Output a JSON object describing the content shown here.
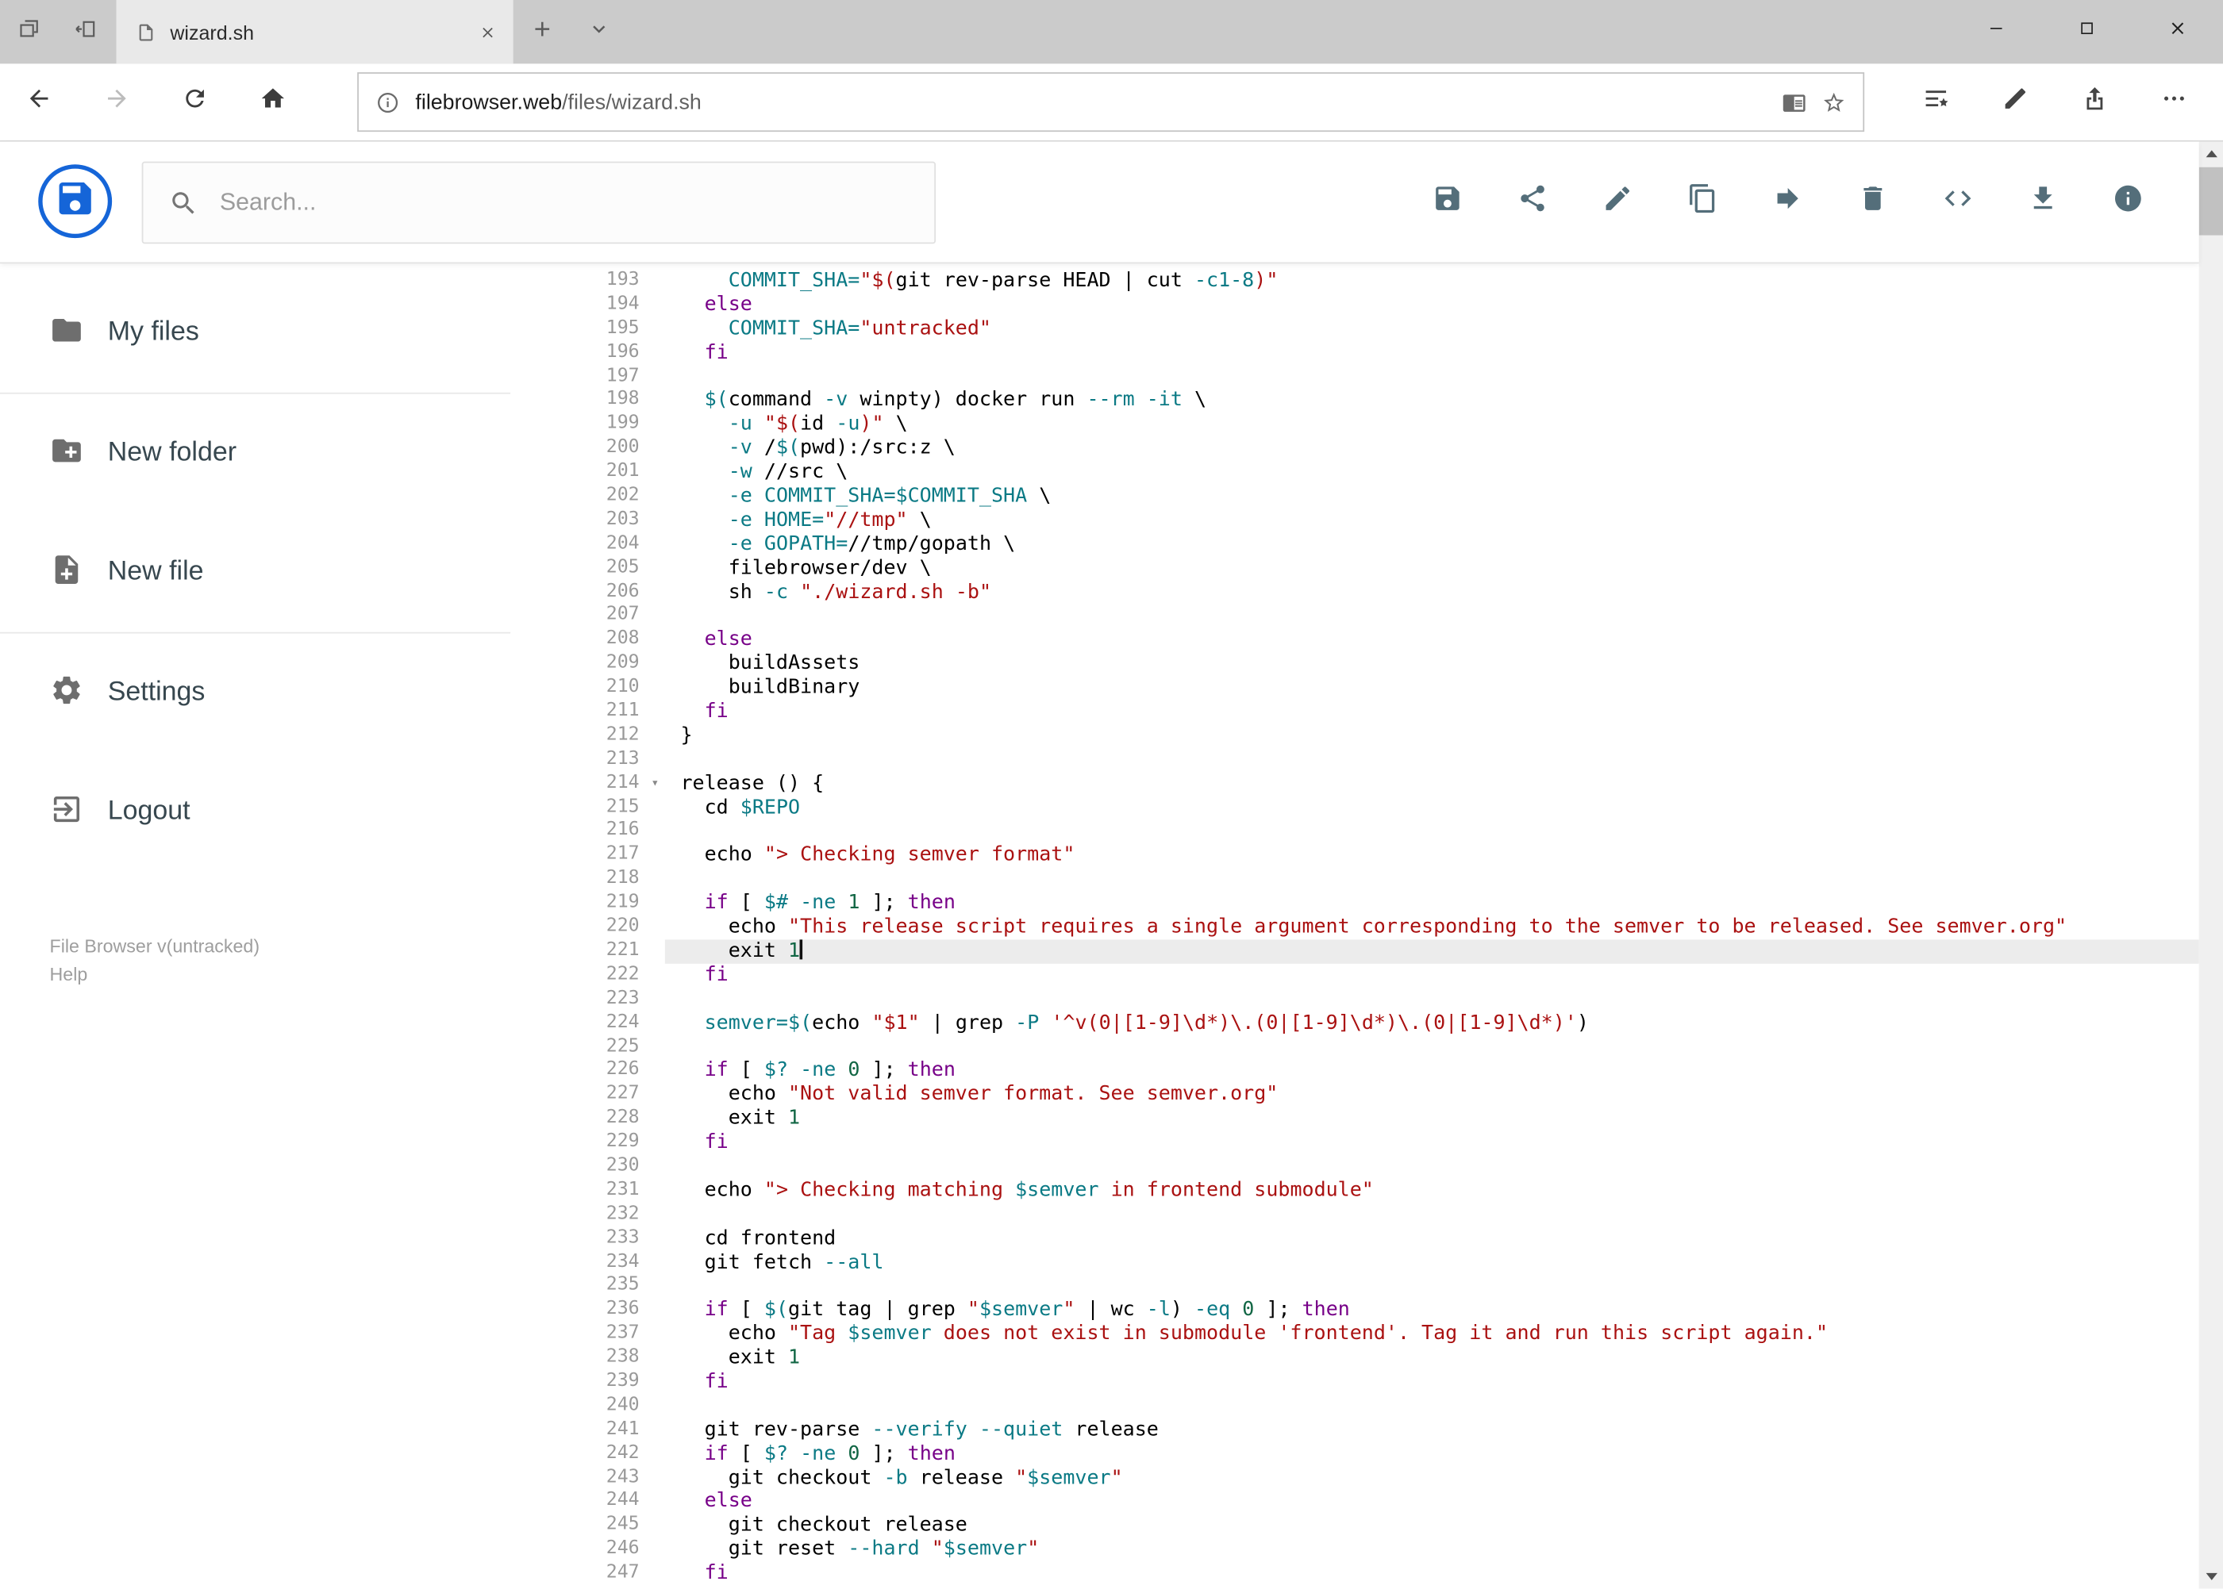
{
  "browser": {
    "tab_title": "wizard.sh",
    "url_domain": "filebrowser.web",
    "url_path": "/files/wizard.sh"
  },
  "app": {
    "search_placeholder": "Search...",
    "sidebar": {
      "items": [
        {
          "label": "My files"
        },
        {
          "label": "New folder"
        },
        {
          "label": "New file"
        },
        {
          "label": "Settings"
        },
        {
          "label": "Logout"
        }
      ],
      "version": "File Browser v(untracked)",
      "help": "Help"
    },
    "icons": {
      "tabstrip": [
        "tabs-preview-icon",
        "set-tabs-aside-icon",
        "page-icon",
        "close-tab-icon",
        "new-tab-icon",
        "tab-actions-chevron-icon",
        "minimize-icon",
        "maximize-icon",
        "close-window-icon"
      ],
      "navbar": [
        "back-icon",
        "forward-icon",
        "refresh-icon",
        "home-icon",
        "page-info-icon",
        "reading-view-icon",
        "favorite-star-icon",
        "hub-icon",
        "web-note-icon",
        "share-icon",
        "more-icon"
      ],
      "header": [
        "logo-icon",
        "search-icon",
        "save-icon",
        "share-icon",
        "rename-icon",
        "copy-icon",
        "move-icon",
        "delete-icon",
        "switch-view-icon",
        "download-icon",
        "info-icon"
      ],
      "sidebar": [
        "folder-icon",
        "new-folder-icon",
        "new-file-icon",
        "settings-icon",
        "logout-icon"
      ]
    }
  },
  "editor": {
    "active_line": 221,
    "fold_line": 214,
    "colors": {
      "keyword": "#770088",
      "string": "#aa1111",
      "variable": "#0b7a85",
      "number": "#116644",
      "plain": "#000000",
      "line_number": "#999999",
      "active_line_bg": "#ececec"
    },
    "lines": [
      {
        "n": 193,
        "seg": [
          [
            "p",
            "    "
          ],
          [
            "v",
            "COMMIT_SHA="
          ],
          [
            "s",
            "\"$("
          ],
          [
            "p",
            "git rev-parse HEAD | cut "
          ],
          [
            "v",
            "-c1-8"
          ],
          [
            "s",
            ")\""
          ]
        ]
      },
      {
        "n": 194,
        "seg": [
          [
            "p",
            "  "
          ],
          [
            "k",
            "else"
          ]
        ]
      },
      {
        "n": 195,
        "seg": [
          [
            "p",
            "    "
          ],
          [
            "v",
            "COMMIT_SHA="
          ],
          [
            "s",
            "\"untracked\""
          ]
        ]
      },
      {
        "n": 196,
        "seg": [
          [
            "p",
            "  "
          ],
          [
            "k",
            "fi"
          ]
        ]
      },
      {
        "n": 197,
        "seg": []
      },
      {
        "n": 198,
        "seg": [
          [
            "p",
            "  "
          ],
          [
            "v",
            "$("
          ],
          [
            "p",
            "command "
          ],
          [
            "v",
            "-v"
          ],
          [
            "p",
            " winpty) docker run "
          ],
          [
            "v",
            "--rm"
          ],
          [
            "p",
            " "
          ],
          [
            "v",
            "-it"
          ],
          [
            "p",
            " \\"
          ]
        ]
      },
      {
        "n": 199,
        "seg": [
          [
            "p",
            "    "
          ],
          [
            "v",
            "-u"
          ],
          [
            "p",
            " "
          ],
          [
            "s",
            "\"$("
          ],
          [
            "p",
            "id "
          ],
          [
            "v",
            "-u"
          ],
          [
            "s",
            ")\""
          ],
          [
            "p",
            " \\"
          ]
        ]
      },
      {
        "n": 200,
        "seg": [
          [
            "p",
            "    "
          ],
          [
            "v",
            "-v"
          ],
          [
            "p",
            " /"
          ],
          [
            "v",
            "$("
          ],
          [
            "p",
            "pwd):/src:z \\"
          ]
        ]
      },
      {
        "n": 201,
        "seg": [
          [
            "p",
            "    "
          ],
          [
            "v",
            "-w"
          ],
          [
            "p",
            " //src \\"
          ]
        ]
      },
      {
        "n": 202,
        "seg": [
          [
            "p",
            "    "
          ],
          [
            "v",
            "-e"
          ],
          [
            "p",
            " "
          ],
          [
            "v",
            "COMMIT_SHA=$COMMIT_SHA"
          ],
          [
            "p",
            " \\"
          ]
        ]
      },
      {
        "n": 203,
        "seg": [
          [
            "p",
            "    "
          ],
          [
            "v",
            "-e"
          ],
          [
            "p",
            " "
          ],
          [
            "v",
            "HOME="
          ],
          [
            "s",
            "\"//tmp\""
          ],
          [
            "p",
            " \\"
          ]
        ]
      },
      {
        "n": 204,
        "seg": [
          [
            "p",
            "    "
          ],
          [
            "v",
            "-e"
          ],
          [
            "p",
            " "
          ],
          [
            "v",
            "GOPATH="
          ],
          [
            "p",
            "//tmp/gopath \\"
          ]
        ]
      },
      {
        "n": 205,
        "seg": [
          [
            "p",
            "    filebrowser/dev \\"
          ]
        ]
      },
      {
        "n": 206,
        "seg": [
          [
            "p",
            "    sh "
          ],
          [
            "v",
            "-c"
          ],
          [
            "p",
            " "
          ],
          [
            "s",
            "\"./wizard.sh -b\""
          ]
        ]
      },
      {
        "n": 207,
        "seg": []
      },
      {
        "n": 208,
        "seg": [
          [
            "p",
            "  "
          ],
          [
            "k",
            "else"
          ]
        ]
      },
      {
        "n": 209,
        "seg": [
          [
            "p",
            "    buildAssets"
          ]
        ]
      },
      {
        "n": 210,
        "seg": [
          [
            "p",
            "    buildBinary"
          ]
        ]
      },
      {
        "n": 211,
        "seg": [
          [
            "p",
            "  "
          ],
          [
            "k",
            "fi"
          ]
        ]
      },
      {
        "n": 212,
        "seg": [
          [
            "p",
            "}"
          ]
        ]
      },
      {
        "n": 213,
        "seg": []
      },
      {
        "n": 214,
        "seg": [
          [
            "p",
            "release () {"
          ]
        ]
      },
      {
        "n": 215,
        "seg": [
          [
            "p",
            "  cd "
          ],
          [
            "v",
            "$REPO"
          ]
        ]
      },
      {
        "n": 216,
        "seg": []
      },
      {
        "n": 217,
        "seg": [
          [
            "p",
            "  echo "
          ],
          [
            "s",
            "\"> Checking semver format\""
          ]
        ]
      },
      {
        "n": 218,
        "seg": []
      },
      {
        "n": 219,
        "seg": [
          [
            "p",
            "  "
          ],
          [
            "k",
            "if"
          ],
          [
            "p",
            " [ "
          ],
          [
            "v",
            "$#"
          ],
          [
            "p",
            " "
          ],
          [
            "v",
            "-ne"
          ],
          [
            "p",
            " "
          ],
          [
            "nu",
            "1"
          ],
          [
            "p",
            " ]; "
          ],
          [
            "k",
            "then"
          ]
        ]
      },
      {
        "n": 220,
        "seg": [
          [
            "p",
            "    echo "
          ],
          [
            "s",
            "\"This release script requires a single argument corresponding to the semver to be released. See semver.org\""
          ]
        ]
      },
      {
        "n": 221,
        "seg": [
          [
            "p",
            "    exit "
          ],
          [
            "nu",
            "1"
          ]
        ]
      },
      {
        "n": 222,
        "seg": [
          [
            "p",
            "  "
          ],
          [
            "k",
            "fi"
          ]
        ]
      },
      {
        "n": 223,
        "seg": []
      },
      {
        "n": 224,
        "seg": [
          [
            "p",
            "  "
          ],
          [
            "v",
            "semver="
          ],
          [
            "v",
            "$("
          ],
          [
            "p",
            "echo "
          ],
          [
            "s",
            "\"$1\""
          ],
          [
            "p",
            " | grep "
          ],
          [
            "v",
            "-P"
          ],
          [
            "p",
            " "
          ],
          [
            "s",
            "'^v(0|[1-9]\\d*)\\.(0|[1-9]\\d*)\\.(0|[1-9]\\d*)'"
          ],
          [
            "p",
            ")"
          ]
        ]
      },
      {
        "n": 225,
        "seg": []
      },
      {
        "n": 226,
        "seg": [
          [
            "p",
            "  "
          ],
          [
            "k",
            "if"
          ],
          [
            "p",
            " [ "
          ],
          [
            "v",
            "$?"
          ],
          [
            "p",
            " "
          ],
          [
            "v",
            "-ne"
          ],
          [
            "p",
            " "
          ],
          [
            "nu",
            "0"
          ],
          [
            "p",
            " ]; "
          ],
          [
            "k",
            "then"
          ]
        ]
      },
      {
        "n": 227,
        "seg": [
          [
            "p",
            "    echo "
          ],
          [
            "s",
            "\"Not valid semver format. See semver.org\""
          ]
        ]
      },
      {
        "n": 228,
        "seg": [
          [
            "p",
            "    exit "
          ],
          [
            "nu",
            "1"
          ]
        ]
      },
      {
        "n": 229,
        "seg": [
          [
            "p",
            "  "
          ],
          [
            "k",
            "fi"
          ]
        ]
      },
      {
        "n": 230,
        "seg": []
      },
      {
        "n": 231,
        "seg": [
          [
            "p",
            "  echo "
          ],
          [
            "s",
            "\"> Checking matching "
          ],
          [
            "v",
            "$semver"
          ],
          [
            "s",
            " in frontend submodule\""
          ]
        ]
      },
      {
        "n": 232,
        "seg": []
      },
      {
        "n": 233,
        "seg": [
          [
            "p",
            "  cd frontend"
          ]
        ]
      },
      {
        "n": 234,
        "seg": [
          [
            "p",
            "  git fetch "
          ],
          [
            "v",
            "--all"
          ]
        ]
      },
      {
        "n": 235,
        "seg": []
      },
      {
        "n": 236,
        "seg": [
          [
            "p",
            "  "
          ],
          [
            "k",
            "if"
          ],
          [
            "p",
            " [ "
          ],
          [
            "v",
            "$("
          ],
          [
            "p",
            "git tag | grep "
          ],
          [
            "s",
            "\""
          ],
          [
            "v",
            "$semver"
          ],
          [
            "s",
            "\""
          ],
          [
            "p",
            " | wc "
          ],
          [
            "v",
            "-l"
          ],
          [
            "p",
            ") "
          ],
          [
            "v",
            "-eq"
          ],
          [
            "p",
            " "
          ],
          [
            "nu",
            "0"
          ],
          [
            "p",
            " ]; "
          ],
          [
            "k",
            "then"
          ]
        ]
      },
      {
        "n": 237,
        "seg": [
          [
            "p",
            "    echo "
          ],
          [
            "s",
            "\"Tag "
          ],
          [
            "v",
            "$semver"
          ],
          [
            "s",
            " does not exist in submodule 'frontend'. Tag it and run this script again.\""
          ]
        ]
      },
      {
        "n": 238,
        "seg": [
          [
            "p",
            "    exit "
          ],
          [
            "nu",
            "1"
          ]
        ]
      },
      {
        "n": 239,
        "seg": [
          [
            "p",
            "  "
          ],
          [
            "k",
            "fi"
          ]
        ]
      },
      {
        "n": 240,
        "seg": []
      },
      {
        "n": 241,
        "seg": [
          [
            "p",
            "  git rev-parse "
          ],
          [
            "v",
            "--verify"
          ],
          [
            "p",
            " "
          ],
          [
            "v",
            "--quiet"
          ],
          [
            "p",
            " release"
          ]
        ]
      },
      {
        "n": 242,
        "seg": [
          [
            "p",
            "  "
          ],
          [
            "k",
            "if"
          ],
          [
            "p",
            " [ "
          ],
          [
            "v",
            "$?"
          ],
          [
            "p",
            " "
          ],
          [
            "v",
            "-ne"
          ],
          [
            "p",
            " "
          ],
          [
            "nu",
            "0"
          ],
          [
            "p",
            " ]; "
          ],
          [
            "k",
            "then"
          ]
        ]
      },
      {
        "n": 243,
        "seg": [
          [
            "p",
            "    git checkout "
          ],
          [
            "v",
            "-b"
          ],
          [
            "p",
            " release "
          ],
          [
            "s",
            "\""
          ],
          [
            "v",
            "$semver"
          ],
          [
            "s",
            "\""
          ]
        ]
      },
      {
        "n": 244,
        "seg": [
          [
            "p",
            "  "
          ],
          [
            "k",
            "else"
          ]
        ]
      },
      {
        "n": 245,
        "seg": [
          [
            "p",
            "    git checkout release"
          ]
        ]
      },
      {
        "n": 246,
        "seg": [
          [
            "p",
            "    git reset "
          ],
          [
            "v",
            "--hard"
          ],
          [
            "p",
            " "
          ],
          [
            "s",
            "\""
          ],
          [
            "v",
            "$semver"
          ],
          [
            "s",
            "\""
          ]
        ]
      },
      {
        "n": 247,
        "seg": [
          [
            "p",
            "  "
          ],
          [
            "k",
            "fi"
          ]
        ]
      }
    ]
  }
}
